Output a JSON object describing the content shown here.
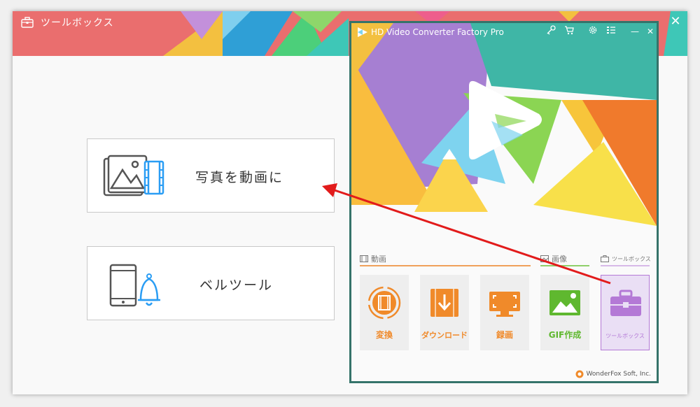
{
  "outer_window": {
    "title": "ツールボックス",
    "close_glyph": "✕"
  },
  "cards": [
    {
      "label": "写真を動画に"
    },
    {
      "label": "ベルツール"
    }
  ],
  "inner_window": {
    "title": "HD Video Converter Factory Pro",
    "controls": {
      "minimize": "—",
      "close": "✕"
    },
    "sections": {
      "video": "動画",
      "image": "画像",
      "toolbox": "ツールボックス"
    },
    "tiles": [
      {
        "label": "変換",
        "color": "#f08a2a",
        "icon": "film-reel-icon"
      },
      {
        "label": "ダウンロード",
        "color": "#f08a2a",
        "icon": "download-icon"
      },
      {
        "label": "録画",
        "color": "#f08a2a",
        "icon": "screen-record-icon"
      },
      {
        "label": "GIF作成",
        "color": "#5fb82f",
        "icon": "image-icon"
      },
      {
        "label": "ツールボックス",
        "color": "#b479d6",
        "icon": "toolbox-icon",
        "selected": true
      }
    ],
    "footer": "WonderFox Soft, Inc."
  },
  "colors": {
    "accent_red_arrow": "#e21b1b",
    "window_border": "#35736a",
    "orange": "#f08a2a",
    "green": "#5fb82f",
    "purple": "#b479d6"
  }
}
